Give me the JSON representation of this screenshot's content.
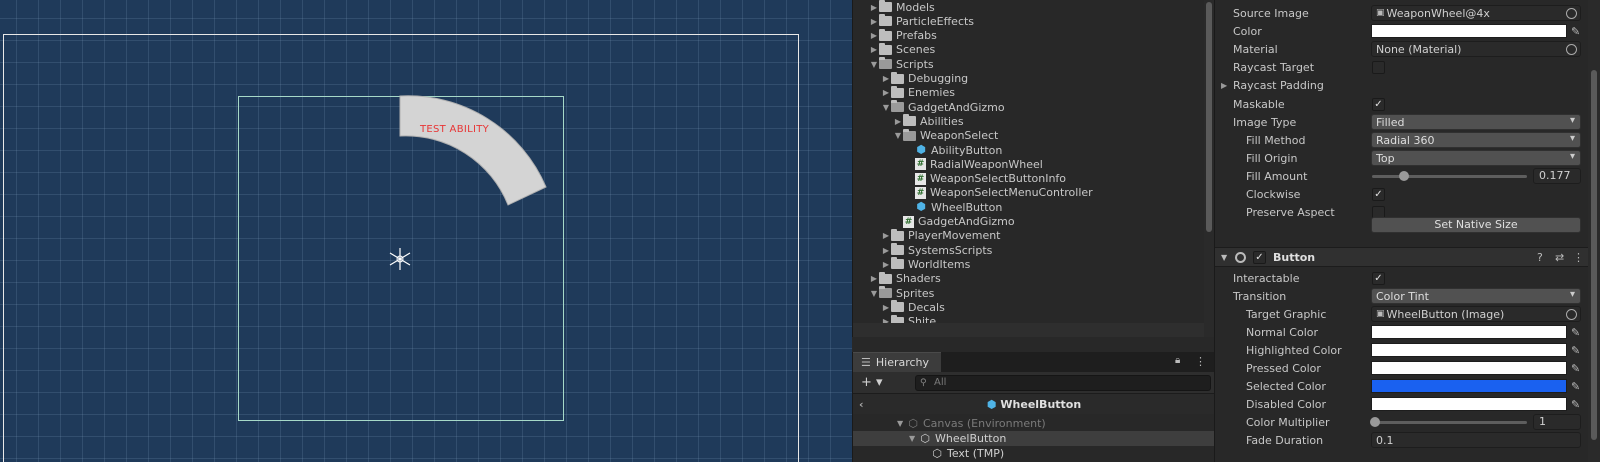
{
  "scene": {
    "wedge_label": "TEST ABILITY"
  },
  "project": {
    "items": [
      {
        "label": "Models",
        "type": "folder",
        "depth": 0,
        "arrow": "right"
      },
      {
        "label": "ParticleEffects",
        "type": "folder",
        "depth": 0,
        "arrow": "right"
      },
      {
        "label": "Prefabs",
        "type": "folder",
        "depth": 0,
        "arrow": "right"
      },
      {
        "label": "Scenes",
        "type": "folder",
        "depth": 0,
        "arrow": "right"
      },
      {
        "label": "Scripts",
        "type": "folder-open",
        "depth": 0,
        "arrow": "down"
      },
      {
        "label": "Debugging",
        "type": "folder",
        "depth": 1,
        "arrow": "right"
      },
      {
        "label": "Enemies",
        "type": "folder",
        "depth": 1,
        "arrow": "right"
      },
      {
        "label": "GadgetAndGizmo",
        "type": "folder-open",
        "depth": 1,
        "arrow": "down"
      },
      {
        "label": "Abilities",
        "type": "folder",
        "depth": 2,
        "arrow": "right"
      },
      {
        "label": "WeaponSelect",
        "type": "folder-open",
        "depth": 2,
        "arrow": "down"
      },
      {
        "label": "AbilityButton",
        "type": "prefab",
        "depth": 3,
        "arrow": ""
      },
      {
        "label": "RadialWeaponWheel",
        "type": "script",
        "depth": 3,
        "arrow": ""
      },
      {
        "label": "WeaponSelectButtonInfo",
        "type": "script",
        "depth": 3,
        "arrow": ""
      },
      {
        "label": "WeaponSelectMenuController",
        "type": "script",
        "depth": 3,
        "arrow": ""
      },
      {
        "label": "WheelButton",
        "type": "prefab",
        "depth": 3,
        "arrow": ""
      },
      {
        "label": "GadgetAndGizmo",
        "type": "script",
        "depth": 2,
        "arrow": ""
      },
      {
        "label": "PlayerMovement",
        "type": "folder",
        "depth": 1,
        "arrow": "right"
      },
      {
        "label": "SystemsScripts",
        "type": "folder",
        "depth": 1,
        "arrow": "right"
      },
      {
        "label": "WorldItems",
        "type": "folder",
        "depth": 1,
        "arrow": "right"
      },
      {
        "label": "Shaders",
        "type": "folder",
        "depth": 0,
        "arrow": "right"
      },
      {
        "label": "Sprites",
        "type": "folder-open",
        "depth": 0,
        "arrow": "down"
      },
      {
        "label": "Decals",
        "type": "folder",
        "depth": 1,
        "arrow": "right"
      },
      {
        "label": "Shite",
        "type": "folder",
        "depth": 1,
        "arrow": "right"
      }
    ]
  },
  "hierarchy": {
    "tab_label": "Hierarchy",
    "add_label": "+ ▾",
    "search_placeholder": "All",
    "title": "WheelButton",
    "rows": [
      {
        "label": "Canvas (Environment)",
        "depth": 0,
        "arrow": "▼",
        "dim": true,
        "selected": false
      },
      {
        "label": "WheelButton",
        "depth": 1,
        "arrow": "▼",
        "dim": false,
        "selected": true
      },
      {
        "label": "Text (TMP)",
        "depth": 2,
        "arrow": "",
        "dim": false,
        "selected": false
      }
    ]
  },
  "inspector": {
    "source_image": {
      "label": "Source Image",
      "value": "WeaponWheel@4x"
    },
    "color": {
      "label": "Color",
      "value": "#ffffff"
    },
    "material": {
      "label": "Material",
      "value": "None (Material)"
    },
    "raycast_target": {
      "label": "Raycast Target",
      "checked": false
    },
    "raycast_padding": {
      "label": "Raycast Padding"
    },
    "maskable": {
      "label": "Maskable",
      "checked": true
    },
    "image_type": {
      "label": "Image Type",
      "value": "Filled"
    },
    "fill_method": {
      "label": "Fill Method",
      "value": "Radial 360"
    },
    "fill_origin": {
      "label": "Fill Origin",
      "value": "Top"
    },
    "fill_amount": {
      "label": "Fill Amount",
      "value": "0.177",
      "fraction": 0.177
    },
    "clockwise": {
      "label": "Clockwise",
      "checked": true
    },
    "preserve_aspect": {
      "label": "Preserve Aspect",
      "checked": false
    },
    "set_native_size": "Set Native Size",
    "button_component": {
      "title": "Button",
      "enabled": true
    },
    "interactable": {
      "label": "Interactable",
      "checked": true
    },
    "transition": {
      "label": "Transition",
      "value": "Color Tint"
    },
    "target_graphic": {
      "label": "Target Graphic",
      "value": "WheelButton (Image)"
    },
    "normal_color": {
      "label": "Normal Color",
      "value": "#ffffff"
    },
    "highlighted_color": {
      "label": "Highlighted Color",
      "value": "#ffffff"
    },
    "pressed_color": {
      "label": "Pressed Color",
      "value": "#ffffff"
    },
    "selected_color": {
      "label": "Selected Color",
      "value": "#1a61f0"
    },
    "disabled_color": {
      "label": "Disabled Color",
      "value": "#ffffff"
    },
    "color_multiplier": {
      "label": "Color Multiplier",
      "value": "1",
      "fraction": 0
    },
    "fade_duration": {
      "label": "Fade Duration",
      "value": "0.1"
    }
  }
}
